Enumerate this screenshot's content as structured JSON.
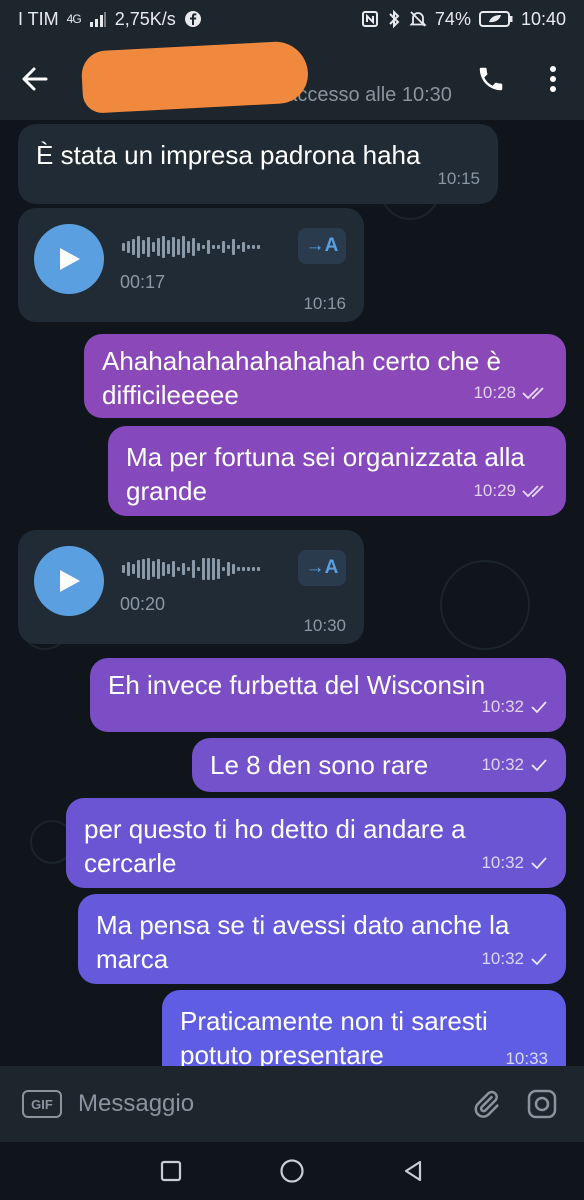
{
  "status_bar": {
    "carrier": "I TIM",
    "network": "4G",
    "speed": "2,75K/s",
    "battery": "74%",
    "time": "10:40"
  },
  "header": {
    "last_seen": "Ultimo accesso alle 10:30",
    "back_icon": "arrow-left-icon",
    "call_icon": "phone-icon",
    "menu_icon": "more-vert-icon"
  },
  "messages": [
    {
      "type": "text",
      "dir": "in",
      "text": "È stata un impresa padrona haha",
      "time": "10:15"
    },
    {
      "type": "voice",
      "dir": "in",
      "duration": "00:17",
      "transcribe_label": "→A",
      "time": "10:16"
    },
    {
      "type": "text",
      "dir": "out",
      "text": "Ahahahahahahahahah certo che è difficileeeee",
      "time": "10:28",
      "status": "read"
    },
    {
      "type": "text",
      "dir": "out",
      "text": "Ma per fortuna sei organizzata alla grande",
      "time": "10:29",
      "status": "read"
    },
    {
      "type": "voice",
      "dir": "in",
      "duration": "00:20",
      "transcribe_label": "→A",
      "time": "10:30"
    },
    {
      "type": "text",
      "dir": "out",
      "text": "Eh invece furbetta del Wisconsin",
      "time": "10:32",
      "status": "sent"
    },
    {
      "type": "text",
      "dir": "out",
      "text": "Le 8 den sono rare",
      "time": "10:32",
      "status": "sent"
    },
    {
      "type": "text",
      "dir": "out",
      "text": "per questo ti ho detto di andare a cercarle",
      "time": "10:32",
      "status": "sent"
    },
    {
      "type": "text",
      "dir": "out",
      "text": "Ma pensa se ti avessi dato anche la marca",
      "time": "10:32",
      "status": "sent"
    },
    {
      "type": "text",
      "dir": "out",
      "text": "Praticamente non ti saresti potuto presentare",
      "time": "10:33",
      "status": "sent"
    }
  ],
  "input": {
    "gif_label": "GIF",
    "placeholder": "Messaggio"
  },
  "colors": {
    "outgoing_gradient": [
      "#8e44b8",
      "#6a5fe6"
    ],
    "incoming": "#212b35",
    "accent": "#5aa0e0"
  }
}
